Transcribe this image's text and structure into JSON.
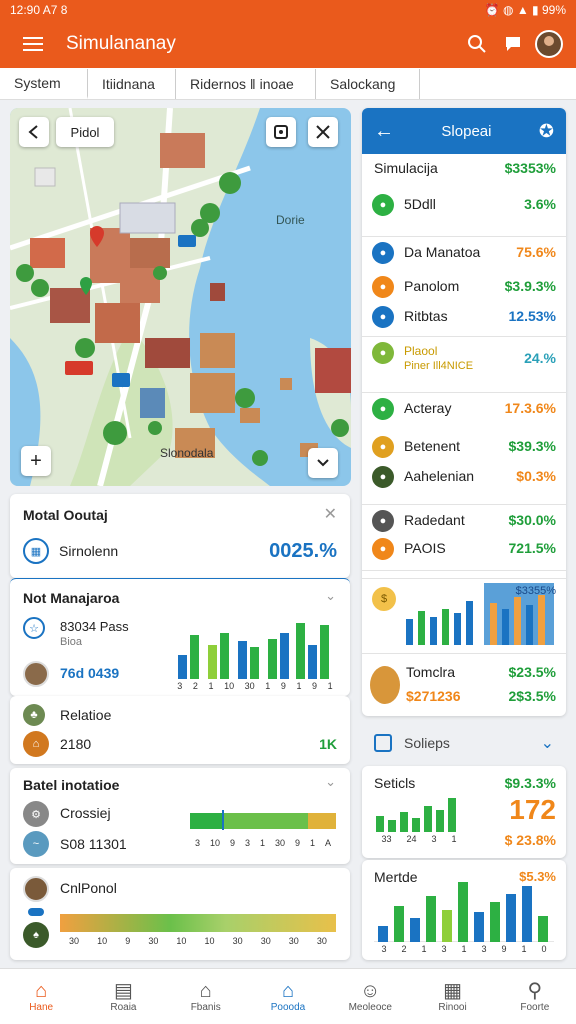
{
  "status": {
    "time": "12:90 A7 8",
    "right": "99%"
  },
  "appbar": {
    "title": "Simulananay"
  },
  "tabs": [
    {
      "label": "System"
    },
    {
      "label": "Itiidnana"
    },
    {
      "label": "Ridernos  ‖  inoae"
    },
    {
      "label": "Salockang"
    }
  ],
  "map": {
    "chip": "Pidol",
    "labels": {
      "water": "Dorie",
      "bottom": "Slonodala"
    }
  },
  "left": {
    "card1": {
      "title": "Motal Ooutaj",
      "row_label": "Sirnolenn",
      "row_value": "0025.%"
    },
    "card2": {
      "title": "Not Manajaroa",
      "row1_line1": "83034 Pass",
      "row1_line2": "Bioa",
      "row2_value": "76d 0439",
      "ticks": [
        "3",
        "2",
        "1",
        "10",
        "30",
        "1",
        "9",
        "1",
        "9",
        "1"
      ]
    },
    "card3": {
      "row1_label": "Relatioe",
      "row2_value": "2180",
      "row2_right": "1K"
    },
    "card4": {
      "title": "Batel inotatioe",
      "row1_label": "Crossiej",
      "row2_value": "S08 11301",
      "ticks": [
        "3",
        "10",
        "9",
        "3",
        "1",
        "30",
        "9",
        "1",
        "A"
      ]
    },
    "card5": {
      "row_label": "CnlPonol",
      "ticks": [
        "30",
        "10",
        "9",
        "30",
        "10",
        "10",
        "30",
        "30",
        "30",
        "30"
      ]
    }
  },
  "right": {
    "header": {
      "title": "Slopeai"
    },
    "rows": [
      {
        "label": "Simulacija",
        "value": "$3353%"
      },
      {
        "label": "5Ddll",
        "value": "3.6%"
      },
      {
        "label": "Da Manatoa",
        "value": "75.6%"
      },
      {
        "label": "Panolom",
        "value": "$3.9.3%"
      },
      {
        "label": "Ritbtas",
        "value": "12.53%"
      },
      {
        "label": "Plaool",
        "sub": "Piner Ill4NICE",
        "value": "24.%"
      },
      {
        "label": "Acteray",
        "value": "17.3.6%"
      },
      {
        "label": "Betenent",
        "value": "$39.3%"
      },
      {
        "label": "Aahelenian",
        "value": "$0.3%"
      },
      {
        "label": "Radedant",
        "value": "$30.0%"
      },
      {
        "label": "PAOIS",
        "value": "721.5%"
      }
    ],
    "chartcard": {
      "badge": "$3355%"
    },
    "bottomrow": {
      "label": "Tomclra",
      "sub": "$271236",
      "value1": "$23.5%",
      "value2": "2$3.5%"
    },
    "solieps": {
      "title": "Solieps"
    },
    "card6": {
      "title": "Seticls",
      "value1": "$9.3.3%",
      "big": "172",
      "value2": "$ 23.8%",
      "ticks": [
        "33",
        "24",
        "3",
        "1"
      ]
    },
    "card7": {
      "title": "Mertde",
      "value1": "$5.3%",
      "ticks": [
        "3",
        "2",
        "1",
        "3",
        "1",
        "3",
        "9",
        "1",
        "0"
      ]
    }
  },
  "bottomnav": [
    {
      "label": "Hane",
      "icon": "home-icon"
    },
    {
      "label": "Roaia",
      "icon": "document-icon"
    },
    {
      "label": "Fbanis",
      "icon": "building-icon"
    },
    {
      "label": "Poooda",
      "icon": "home-icon"
    },
    {
      "label": "Meoleoce",
      "icon": "face-icon"
    },
    {
      "label": "Rinooi",
      "icon": "stack-icon"
    },
    {
      "label": "Foorte",
      "icon": "profile-icon"
    }
  ],
  "colors": {
    "accent": "#ea5a1c",
    "blue": "#1a73c2",
    "green": "#1f9e3a",
    "orange": "#f0871a"
  }
}
